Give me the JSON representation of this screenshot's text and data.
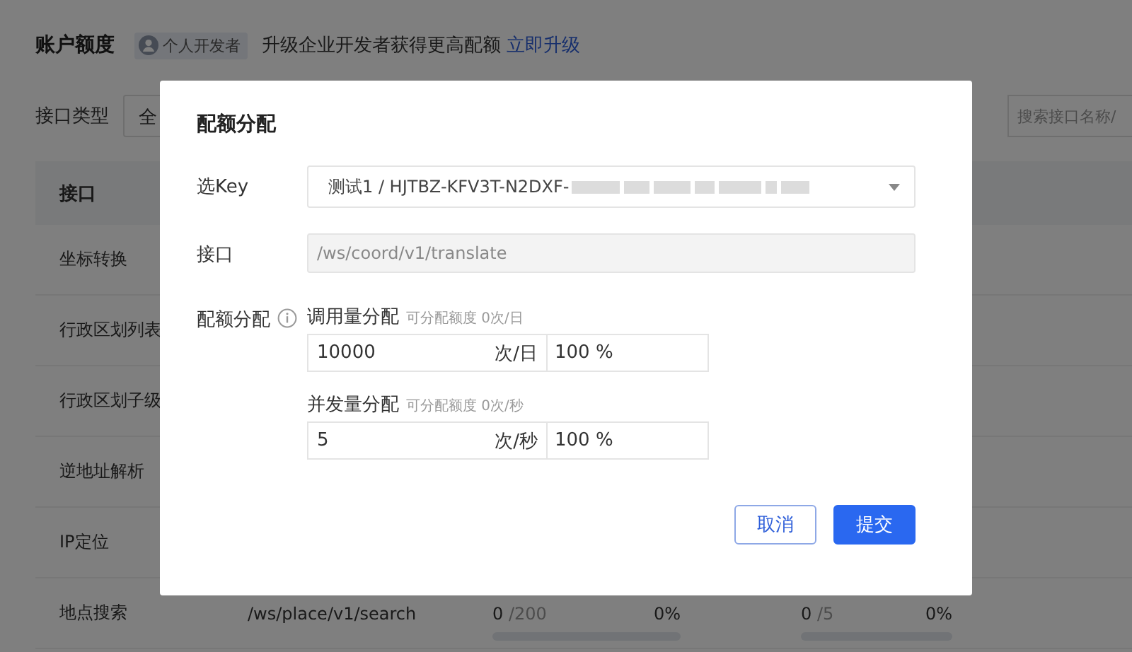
{
  "page": {
    "title": "账户额度",
    "badge": "个人开发者",
    "upgrade_text": "升级企业开发者获得更高配额",
    "upgrade_link": "立即升级"
  },
  "filter": {
    "label": "接口类型",
    "select_value": "全",
    "search_placeholder": "搜索接口名称/"
  },
  "table": {
    "columns": [
      "接口"
    ],
    "rows": [
      {
        "name": "坐标转换"
      },
      {
        "name": "行政区划列表"
      },
      {
        "name": "行政区划子级"
      },
      {
        "name": "逆地址解析"
      },
      {
        "name": "IP定位"
      },
      {
        "name": "地点搜索",
        "path": "/ws/place/v1/search",
        "usage": {
          "used": "0",
          "total": "/200",
          "percent": "0%",
          "level": 0
        },
        "concurrency": {
          "used": "0",
          "total": "/5",
          "percent": "0%",
          "level": 0
        }
      }
    ]
  },
  "dialog": {
    "title": "配额分配",
    "fields": [
      {
        "kind": "select",
        "label": "选Key",
        "value": "测试1 / HJTBZ-KFV3T-N2DXF-",
        "redacted": true
      },
      {
        "kind": "readonly",
        "label": "接口",
        "value": "/ws/coord/v1/translate"
      },
      {
        "kind": "quota",
        "label": "配额分配",
        "groups": [
          {
            "title": "调用量分配",
            "hint": "可分配额度 0次/日",
            "value": "10000",
            "unit": "次/日",
            "percent": "100 %"
          },
          {
            "title": "并发量分配",
            "hint": "可分配额度 0次/秒",
            "value": "5",
            "unit": "次/秒",
            "percent": "100 %"
          }
        ]
      }
    ],
    "buttons": [
      {
        "label": "取消",
        "kind": "secondary"
      },
      {
        "label": "提交",
        "kind": "primary"
      }
    ]
  }
}
